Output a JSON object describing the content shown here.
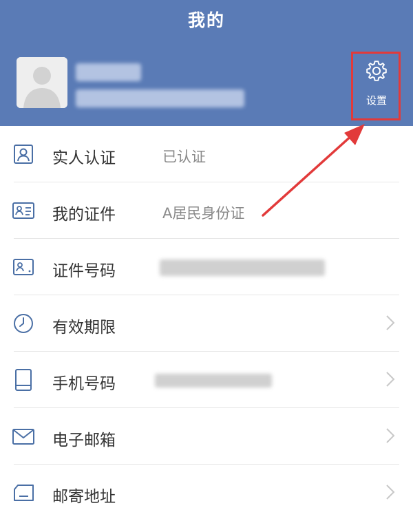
{
  "header": {
    "title": "我的"
  },
  "settings": {
    "label": "设置"
  },
  "menu": [
    {
      "label": "实人认证",
      "value": "已认证",
      "icon": "person-id-icon"
    },
    {
      "label": "我的证件",
      "value": "A居民身份证",
      "icon": "id-card-icon"
    },
    {
      "label": "证件号码",
      "value": "",
      "icon": "id-number-icon"
    },
    {
      "label": "有效期限",
      "value": "",
      "icon": "clock-icon"
    },
    {
      "label": "手机号码",
      "value": "",
      "icon": "phone-icon"
    },
    {
      "label": "电子邮箱",
      "value": "",
      "icon": "mail-icon"
    },
    {
      "label": "邮寄地址",
      "value": "",
      "icon": "address-icon"
    }
  ],
  "colors": {
    "header_bg": "#5a7bb6",
    "icon": "#4a6fa5",
    "highlight": "#e23a3a"
  }
}
